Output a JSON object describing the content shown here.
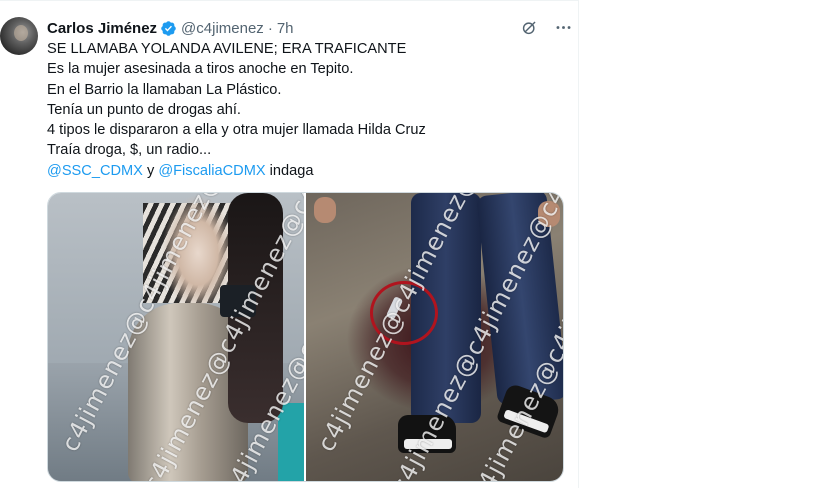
{
  "author": {
    "name": "Carlos Jiménez",
    "handle": "@c4jimenez",
    "separator": "·",
    "time": "7h",
    "verified_color": "#1d9bf0"
  },
  "header_icons": [
    "grok-icon",
    "more-icon"
  ],
  "tweet": {
    "lines": [
      "SE LLAMABA YOLANDA AVILENE; ERA TRAFICANTE",
      "Es la mujer asesinada a tiros  anoche en Tepito.",
      "En el Barrio la llamaban La Plástico.",
      "Tenía un punto de drogas ahí.",
      "4 tipos le dispararon a ella y otra mujer llamada Hilda Cruz",
      "Traía droga, $, un radio..."
    ],
    "mention1": "@SSC_CDMX",
    "connector": " y ",
    "mention2": "@FiscaliaCDMX",
    "tail": " indaga",
    "mention_color": "#1d9bf0"
  },
  "media": {
    "watermark": "c4jimenez@c4jimenez@c4jimenez"
  }
}
